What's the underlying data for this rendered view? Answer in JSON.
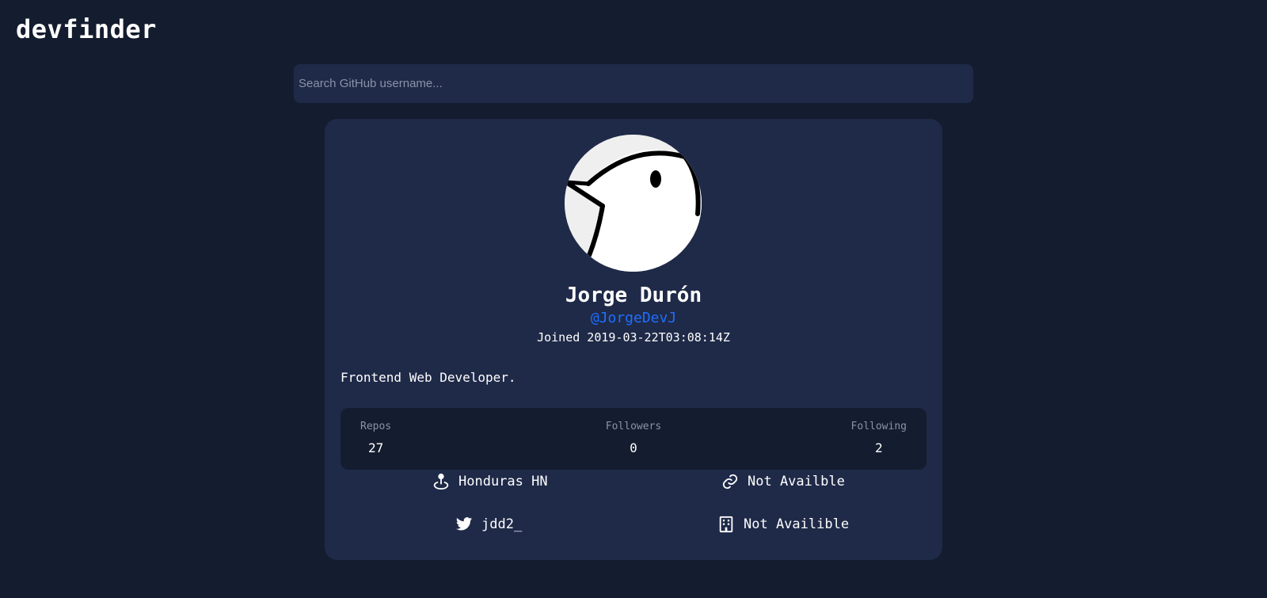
{
  "app": {
    "title": "devfinder"
  },
  "search": {
    "placeholder": "Search GitHub username..."
  },
  "profile": {
    "name": "Jorge Durón",
    "handle": "@JorgeDevJ",
    "joined": "Joined 2019-03-22T03:08:14Z",
    "bio": "Frontend Web Developer.",
    "avatar_icon": "bird-avatar"
  },
  "stats": {
    "repos_label": "Repos",
    "repos_value": "27",
    "followers_label": "Followers",
    "followers_value": "0",
    "following_label": "Following",
    "following_value": "2"
  },
  "links": {
    "location": {
      "icon": "location-pin-icon",
      "text": "Honduras HN"
    },
    "blog": {
      "icon": "link-icon",
      "text": "Not Availble"
    },
    "twitter": {
      "icon": "twitter-icon",
      "text": "jdd2_"
    },
    "company": {
      "icon": "building-icon",
      "text": "Not Availible"
    }
  },
  "colors": {
    "background": "#141c2f",
    "card": "#1f2a48",
    "accent": "#1e6fff",
    "muted": "#8b93a8"
  }
}
